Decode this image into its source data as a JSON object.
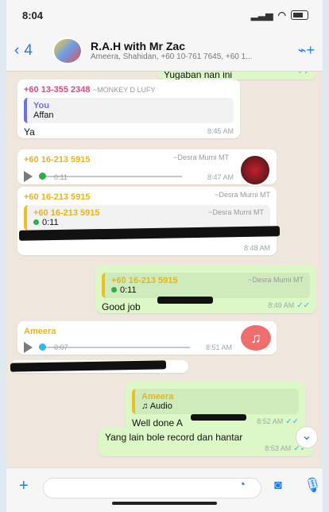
{
  "status": {
    "time": "8:04"
  },
  "header": {
    "back_count": "4",
    "title": "R.A.H with Mr Zac",
    "subtitle": "Ameera, Shahidan, +60 10-761 7645, +60 1..."
  },
  "messages": {
    "top_partial_text": "Yugaban nan ini",
    "monkey": {
      "sender": "+60 13-355 2348",
      "alias": "~MONKEY D LUFY",
      "quote_you": "You",
      "quote_text": "Affan",
      "body": "Ya",
      "time": "8:45 AM"
    },
    "desra_audio": {
      "sender": "+60 16-213 5915",
      "alias": "~Desra Murni MT",
      "duration": "0:11",
      "time": "8:47 AM"
    },
    "desra_reply": {
      "sender": "+60 16-213 5915",
      "alias": "~Desra Murni MT",
      "quote_sender": "+60 16-213 5915",
      "quote_alias": "~Desra Murni MT",
      "quote_duration": "0:11",
      "time": "8:48 AM"
    },
    "good_job": {
      "quote_sender": "+60 16-213 5915",
      "quote_alias": "~Desra Murni MT",
      "quote_duration": "0:11",
      "body": "Good job",
      "time": "8:49 AM"
    },
    "ameera_audio": {
      "sender": "Ameera",
      "duration": "0:07",
      "time": "8:51 AM"
    },
    "well_done": {
      "quote_sender": "Ameera",
      "quote_text": "Audio",
      "body": "Well done A",
      "time": "8:52 AM"
    },
    "yang_lain": {
      "body": "Yang lain bole record dan hantar",
      "time": "8:53 AM"
    }
  },
  "footer": {
    "input_placeholder": ""
  },
  "colors": {
    "accent": "#1b7cf2",
    "out_bubble": "#dcf8c6",
    "in_bubble": "#ffffff",
    "pink_sender": "#e04386",
    "gold_sender": "#f0bd24",
    "audio_red": "#ee6d6d"
  },
  "icons": {
    "back": "chevron-left-icon",
    "add_call": "add-call-icon",
    "play": "play-icon",
    "music": "music-note-icon",
    "plus": "plus-icon",
    "sticker": "sticker-icon",
    "camera": "camera-icon",
    "mic": "microphone-icon"
  }
}
